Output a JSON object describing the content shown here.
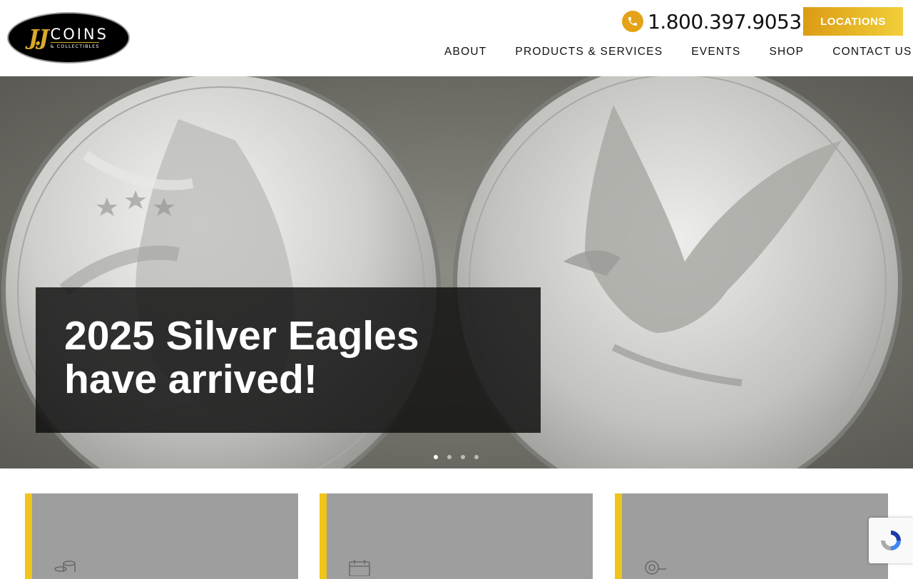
{
  "header": {
    "logo": {
      "mark_text": "J.J",
      "name_text": "COINS",
      "sub_text": "& COLLECTIBLES"
    },
    "phone": "1.800.397.9053",
    "locations_label": "LOCATIONS",
    "nav": [
      {
        "label": "ABOUT"
      },
      {
        "label": "PRODUCTS & SERVICES"
      },
      {
        "label": "EVENTS"
      },
      {
        "label": "SHOP"
      },
      {
        "label": "CONTACT US"
      }
    ]
  },
  "hero": {
    "caption_line1": "2025 Silver Eagles",
    "caption_line2": "have arrived!",
    "slide_count": 4,
    "active_slide": 1
  },
  "cards": [
    {
      "icon": "coins-icon"
    },
    {
      "icon": "calendar-icon"
    },
    {
      "icon": "coin-search-icon"
    }
  ],
  "colors": {
    "accent_gold": "#e4a217",
    "button_gradient_start": "#dc9b14",
    "button_gradient_end": "#f1cf3a",
    "card_bar": "#f0c419",
    "card_bg": "#9e9e9e"
  }
}
